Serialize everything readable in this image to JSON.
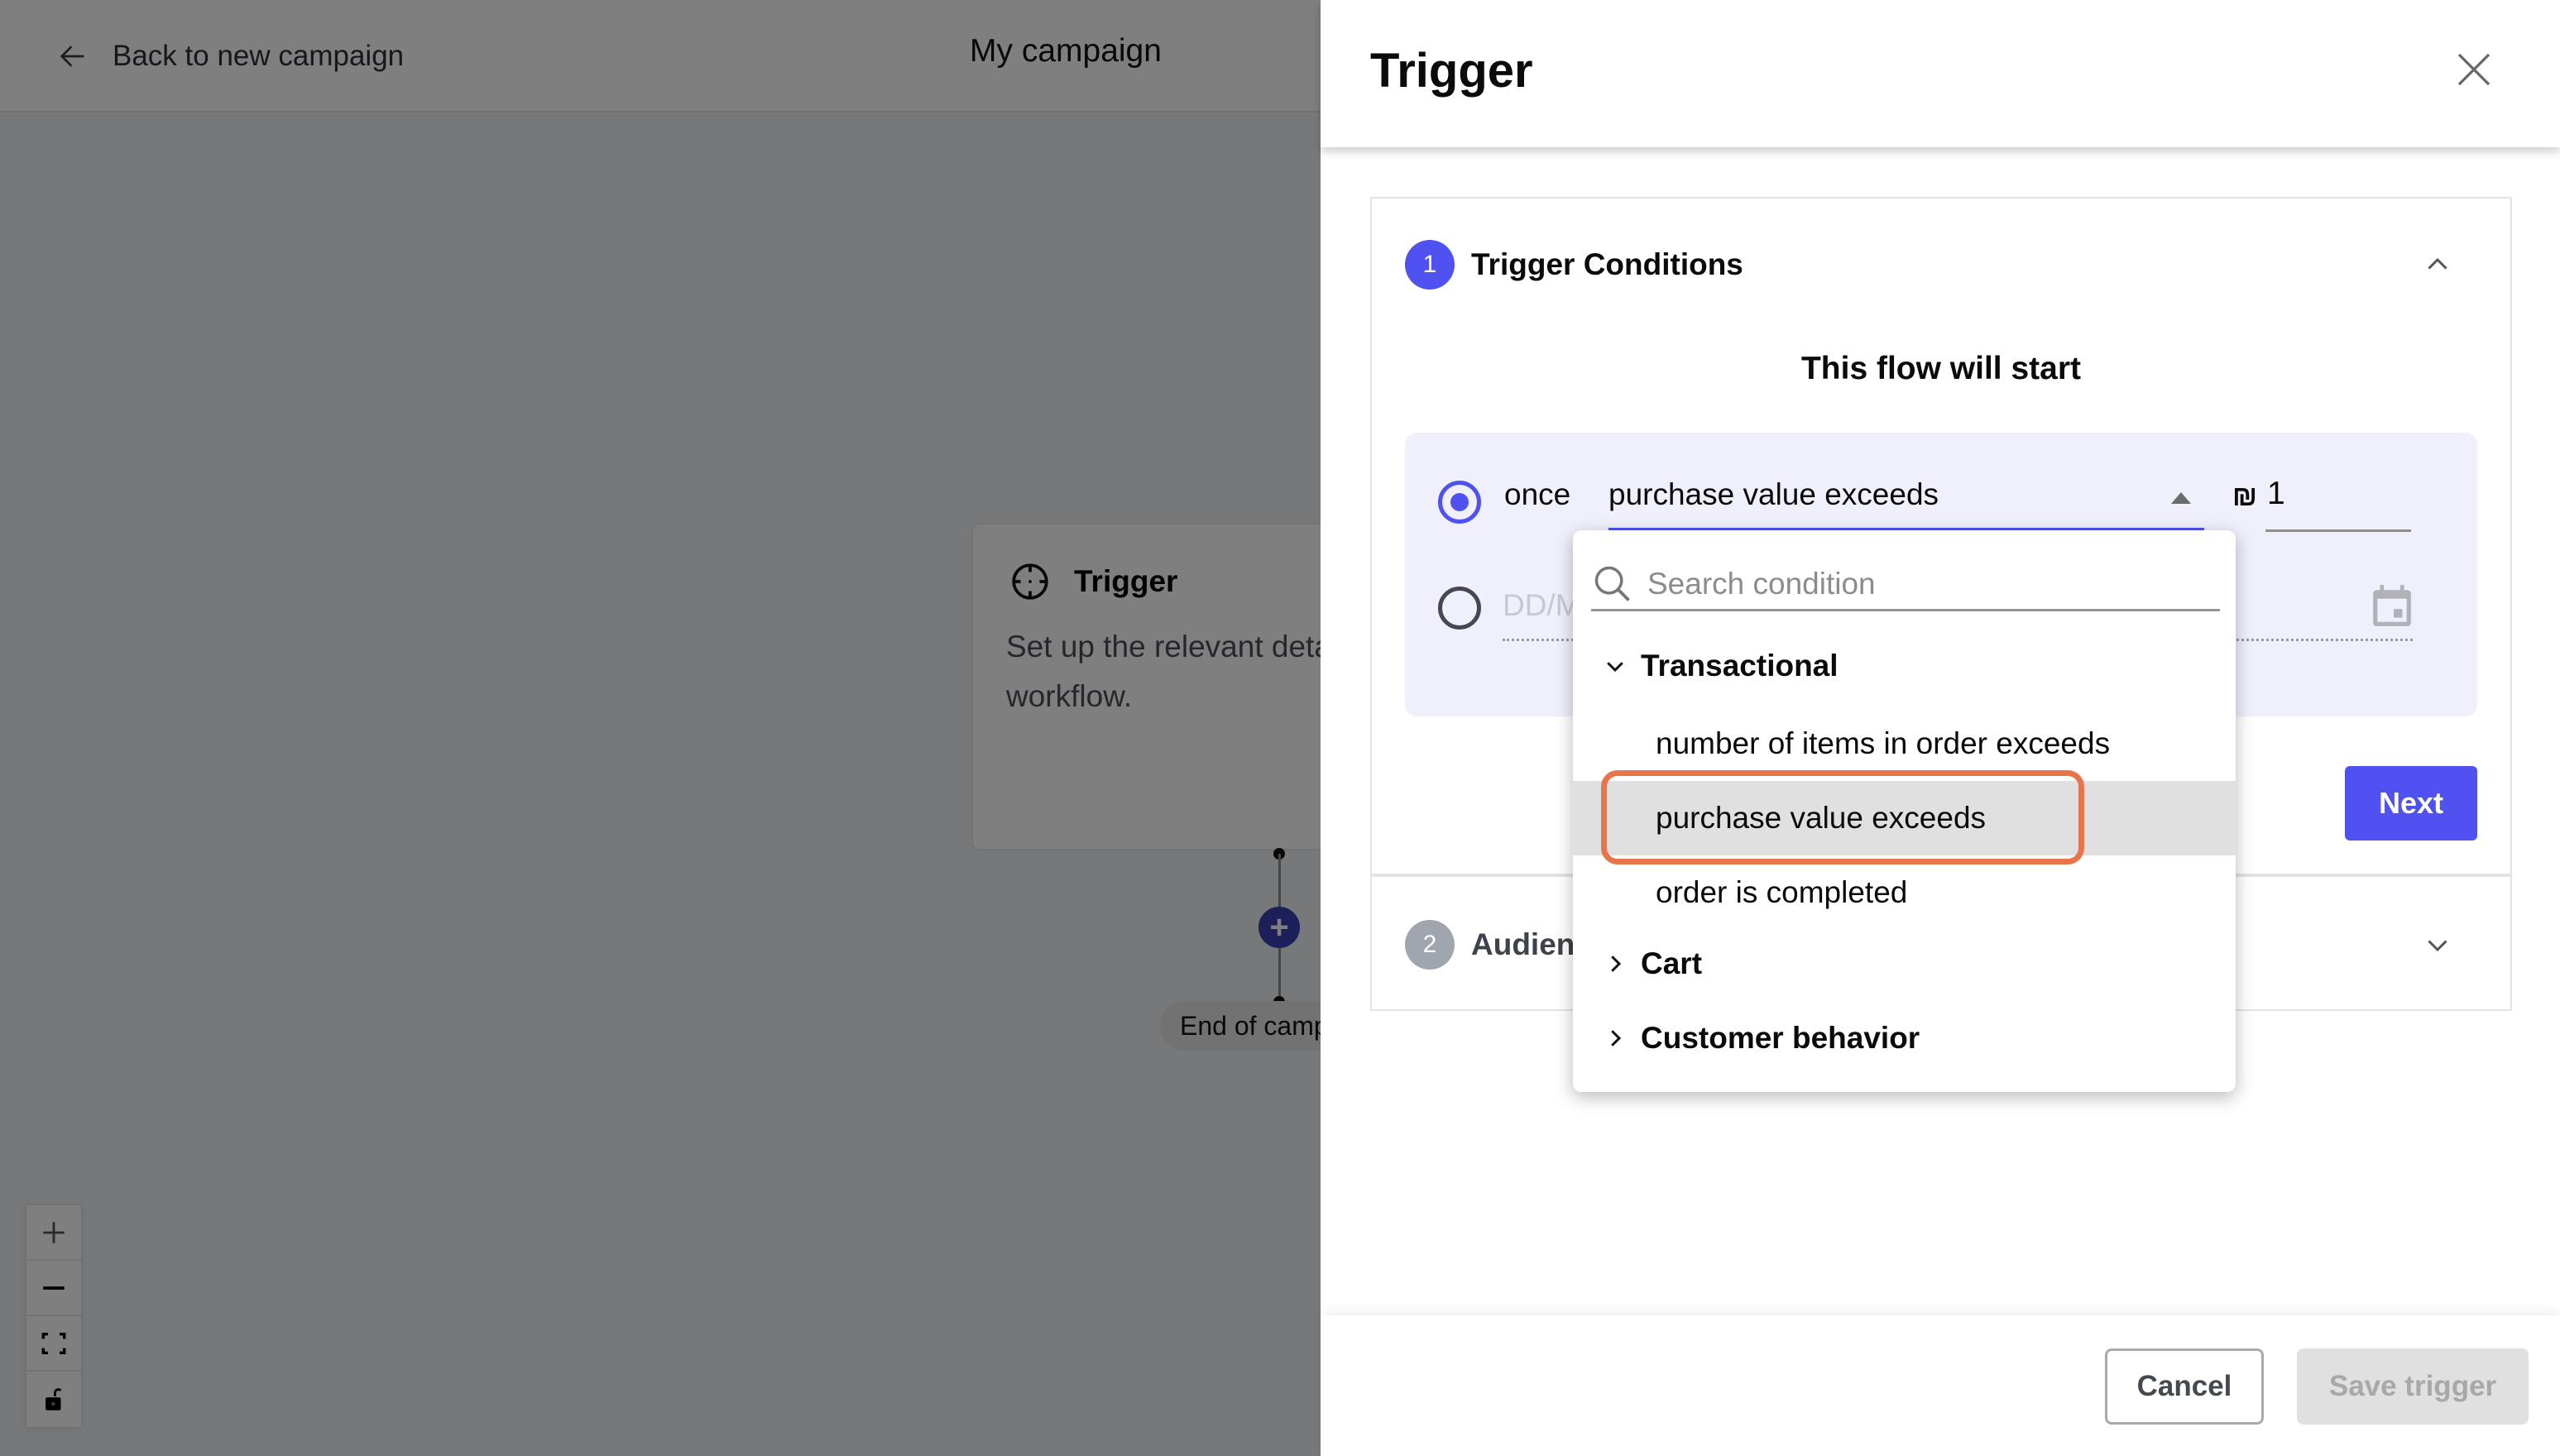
{
  "topbar": {
    "back_label": "Back to new campaign",
    "campaign_title": "My campaign"
  },
  "canvas": {
    "node": {
      "title": "Trigger",
      "description": "Set up the relevant details to start the workflow."
    },
    "add_step_symbol": "+",
    "end_label": "End of campaign",
    "zoom_controls": [
      "zoom-in",
      "zoom-out",
      "fit-view",
      "lock"
    ]
  },
  "panel": {
    "title": "Trigger",
    "steps": [
      {
        "number": "1",
        "label": "Trigger Conditions",
        "expanded": true
      },
      {
        "number": "2",
        "label": "Audience",
        "expanded": false
      }
    ],
    "flow_heading": "This flow will start",
    "condition": {
      "frequency_label": "once",
      "selected_condition": "purchase value exceeds",
      "currency_symbol": "₪",
      "amount": "1",
      "date_placeholder": "DD/MM/YYYY"
    },
    "next_label": "Next",
    "footer": {
      "cancel_label": "Cancel",
      "save_label": "Save trigger"
    }
  },
  "dropdown": {
    "search_placeholder": "Search condition",
    "search_value": "",
    "groups": [
      {
        "label": "Transactional",
        "expanded": true,
        "items": [
          {
            "label": "number of items in order exceeds",
            "hovered": false
          },
          {
            "label": "purchase value exceeds",
            "hovered": true
          },
          {
            "label": "order is completed",
            "hovered": false
          }
        ]
      },
      {
        "label": "Cart",
        "expanded": false
      },
      {
        "label": "Customer behavior",
        "expanded": false
      }
    ]
  },
  "colors": {
    "accent": "#4f52f0",
    "highlight_ring": "#e8744a",
    "condition_box_bg": "#eff0fc",
    "inactive_step": "#a0a6ae"
  }
}
